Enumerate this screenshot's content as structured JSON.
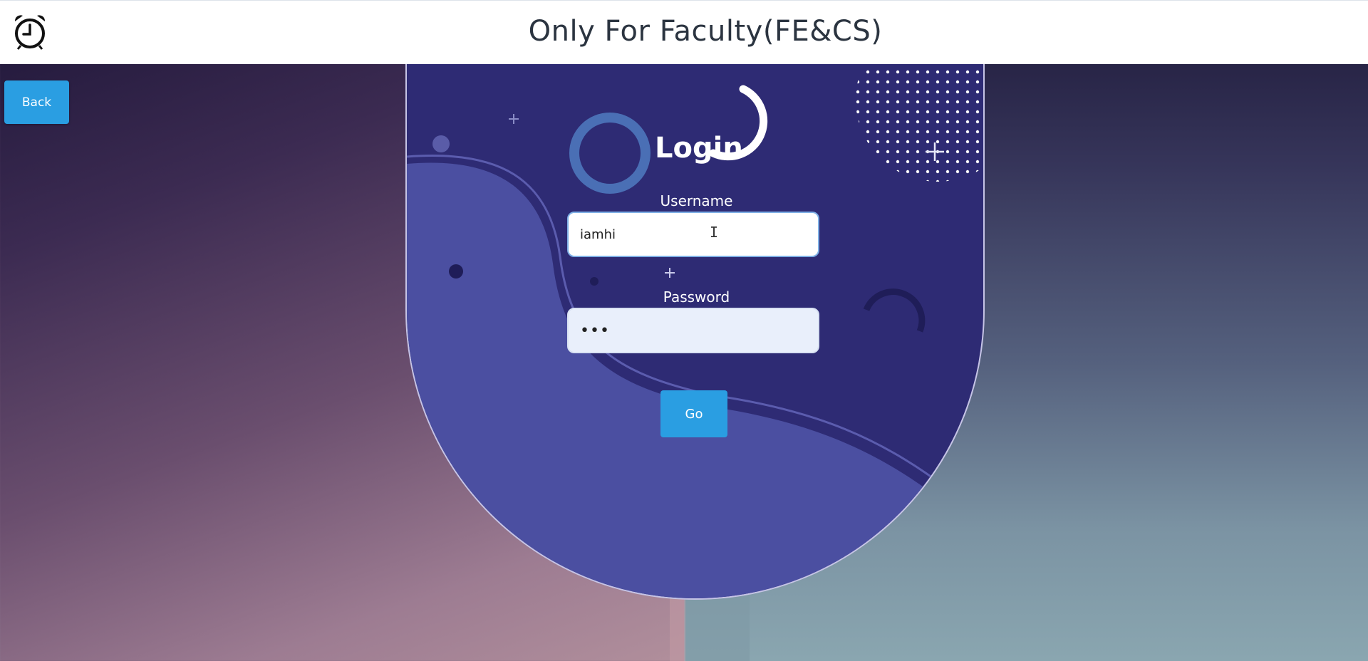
{
  "header": {
    "title": "Only For Faculty(FE&CS)",
    "clock_icon": "alarm-clock-icon"
  },
  "back_button": {
    "label": "Back"
  },
  "login": {
    "title": "Login",
    "username_label": "Username",
    "username_value": "iamhi",
    "password_label": "Password",
    "password_value": "•••",
    "go_label": "Go",
    "cursor_icon": "text-cursor-icon"
  },
  "colors": {
    "card": "#2e2b74",
    "card_wave": "#4b4fa1",
    "button": "#2a9ee2",
    "header_bg": "#ffffff"
  }
}
